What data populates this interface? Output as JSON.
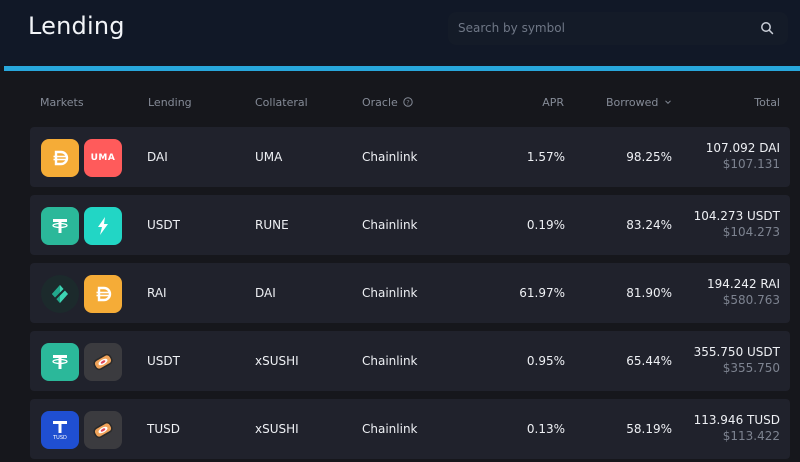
{
  "app": {
    "title": "Lending"
  },
  "search": {
    "placeholder": "Search by symbol"
  },
  "columns": {
    "markets": "Markets",
    "lending": "Lending",
    "collateral": "Collateral",
    "oracle": "Oracle",
    "apr": "APR",
    "borrowed": "Borrowed",
    "total": "Total"
  },
  "rows": [
    {
      "lending": "DAI",
      "collateral": "UMA",
      "oracle": "Chainlink",
      "apr": "1.57%",
      "borrowed": "98.25%",
      "total_amount": "107.092 DAI",
      "total_usd": "$107.131"
    },
    {
      "lending": "USDT",
      "collateral": "RUNE",
      "oracle": "Chainlink",
      "apr": "0.19%",
      "borrowed": "83.24%",
      "total_amount": "104.273 USDT",
      "total_usd": "$104.273"
    },
    {
      "lending": "RAI",
      "collateral": "DAI",
      "oracle": "Chainlink",
      "apr": "61.97%",
      "borrowed": "81.90%",
      "total_amount": "194.242 RAI",
      "total_usd": "$580.763"
    },
    {
      "lending": "USDT",
      "collateral": "xSUSHI",
      "oracle": "Chainlink",
      "apr": "0.95%",
      "borrowed": "65.44%",
      "total_amount": "355.750 USDT",
      "total_usd": "$355.750"
    },
    {
      "lending": "TUSD",
      "collateral": "xSUSHI",
      "oracle": "Chainlink",
      "apr": "0.13%",
      "borrowed": "58.19%",
      "total_amount": "113.946 TUSD",
      "total_usd": "$113.422"
    }
  ],
  "token_logos": {
    "uma_text": "UMA",
    "tusd_text": "TUSD"
  },
  "colors": {
    "accent": "#28a7dc",
    "dai": "#f5ac37",
    "uma": "#ff4a4a",
    "usdt": "#26a17b",
    "rune": "#33ff99",
    "rai": "#1f3d3a",
    "tusd": "#1a5aff",
    "sushi": "#3a3a3a"
  }
}
